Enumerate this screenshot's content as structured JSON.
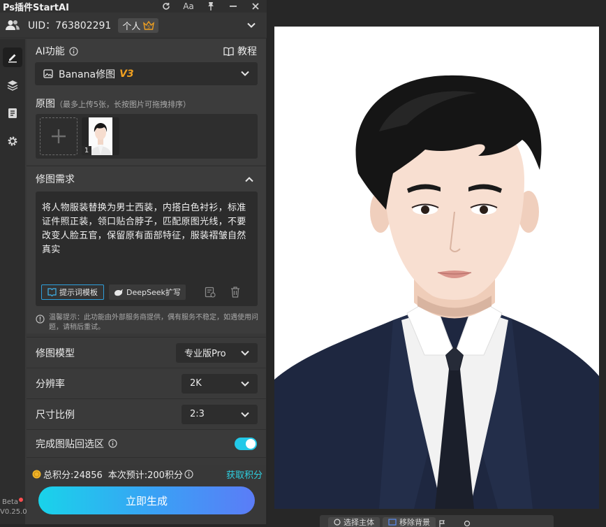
{
  "window": {
    "title": "Ps插件StartAI"
  },
  "titlebar_icons": [
    "refresh-icon",
    "font-size-icon",
    "pin-icon",
    "minimize-icon",
    "close-icon"
  ],
  "titlebar": {
    "font_label": "Aa"
  },
  "account": {
    "uid": "UID：763802291",
    "tier": "个人"
  },
  "ai_function": {
    "label": "AI功能",
    "tutorial": "教程",
    "model_select": "Banana修图",
    "version_tag": "V3"
  },
  "source_images": {
    "label": "原图",
    "hint": "（最多上传5张，长按图片可拖拽排序）",
    "thumb_index": "1"
  },
  "requirements": {
    "label": "修图需求",
    "prompt_text": "将人物服装替换为男士西装，内搭白色衬衫，标准证件照正装，领口贴合脖子，匹配原图光线，不要改变人脸五官，保留原有面部特征，服装褶皱自然真实",
    "template_button": "提示词模板",
    "deepseek_button": "DeepSeek扩写",
    "notice": "温馨提示：此功能由外部服务商提供，偶有服务不稳定，如遇使用问题，请稍后重试。"
  },
  "settings": {
    "model": {
      "label": "修图模型",
      "value": "专业版Pro"
    },
    "resolution": {
      "label": "分辨率",
      "value": "2K"
    },
    "ratio": {
      "label": "尺寸比例",
      "value": "2:3"
    },
    "paste_back": {
      "label": "完成图贴回选区",
      "enabled": true
    }
  },
  "credits": {
    "total": "总积分:24856",
    "estimate": "本次预计:200积分",
    "get_link": "获取积分"
  },
  "generate_button": "立即生成",
  "version": {
    "beta": "Beta",
    "number": "V0.25.0"
  },
  "bottom_toolbar": {
    "select_subject": "选择主体",
    "remove_bg": "移除背景"
  },
  "colors": {
    "accent": "#19c3e6",
    "gold": "#f0a020",
    "link": "#2ecfe0",
    "toggle": "#23c9e8"
  }
}
